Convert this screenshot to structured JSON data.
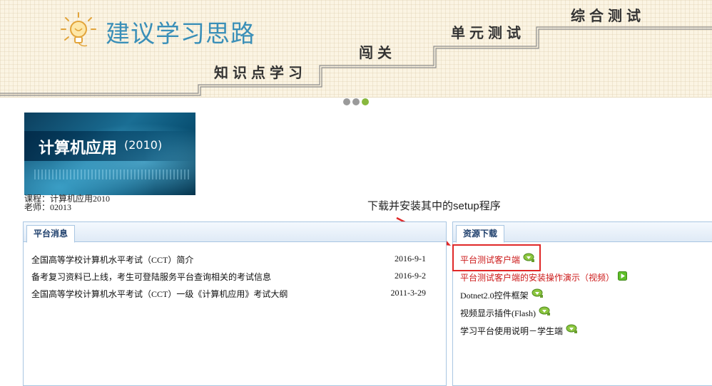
{
  "banner": {
    "title": "建议学习思路",
    "steps": [
      "知识点学习",
      "闯关",
      "单元测试",
      "综合测试"
    ]
  },
  "carousel": {
    "count": 3,
    "active_index": 2
  },
  "course": {
    "image_title": "计算机应用",
    "image_year": "(2010)",
    "course_line": "课程：计算机应用2010",
    "teacher_line": "老师：02013"
  },
  "hint": "下载并安装其中的setup程序",
  "news_panel": {
    "tab": "平台消息",
    "items": [
      {
        "title": "全国高等学校计算机水平考试（CCT）简介",
        "date": "2016-9-1"
      },
      {
        "title": "备考复习资料已上线，考生可登陆服务平台查询相关的考试信息",
        "date": "2016-9-2"
      },
      {
        "title": "全国高等学校计算机水平考试（CCT）一级《计算机应用》考试大纲",
        "date": "2011-3-29"
      }
    ]
  },
  "res_panel": {
    "tab": "资源下载",
    "items": [
      {
        "label": "平台测试客户端",
        "icon": "download-icon"
      },
      {
        "label": "平台测试客户端的安装操作演示（视频）",
        "icon": "play-icon"
      },
      {
        "label": "Dotnet2.0控件框架",
        "icon": "download-icon"
      },
      {
        "label": "视频显示插件(Flash)",
        "icon": "download-icon"
      },
      {
        "label": "学习平台使用说明－学生端",
        "icon": "download-icon"
      }
    ]
  },
  "colors": {
    "banner_title": "#3a8fb8",
    "panel_border": "#a9c6e2",
    "tab_text": "#1e3f6c",
    "link_red": "#cc1a1a",
    "highlight": "#e02828",
    "dot_active": "#88b83e",
    "dot_inactive": "#9a9a9a"
  }
}
